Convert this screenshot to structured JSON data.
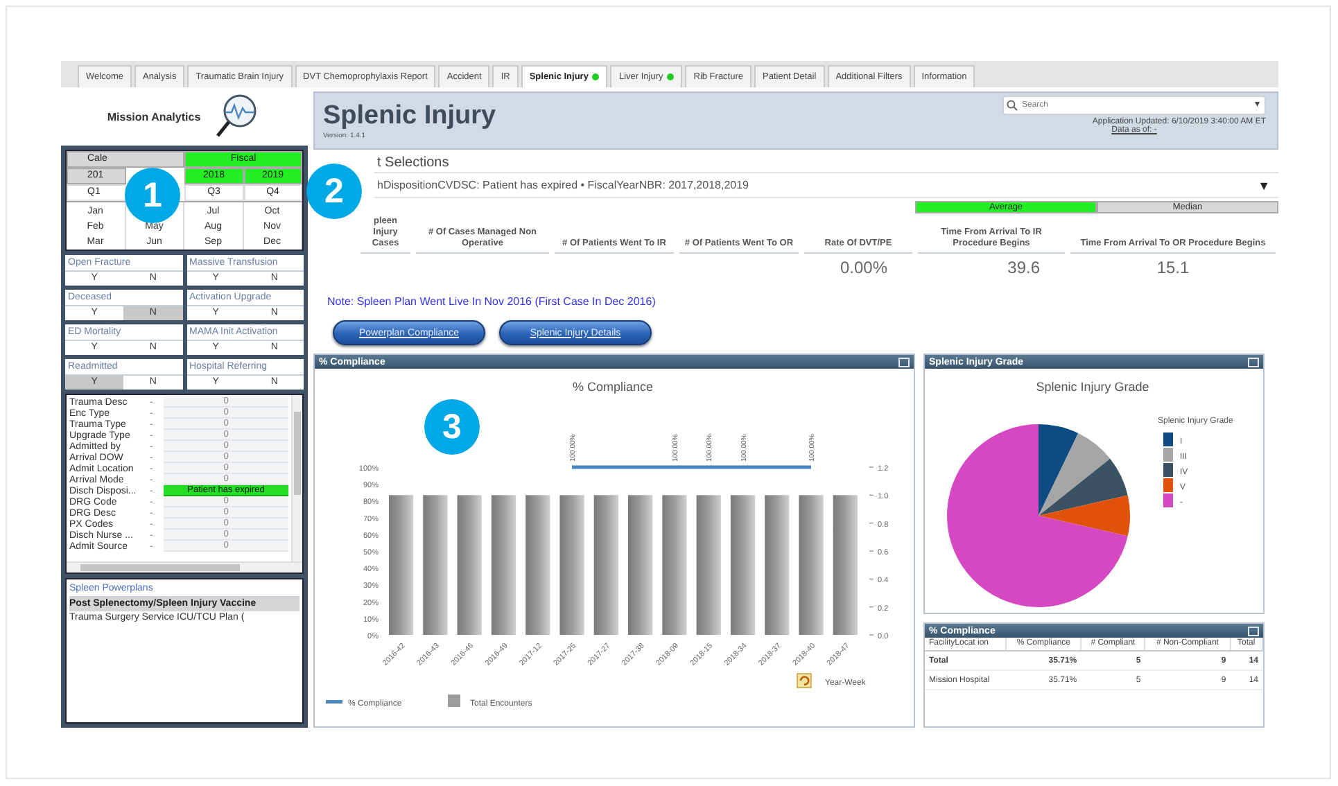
{
  "tabs": [
    {
      "label": "Welcome",
      "selected": false,
      "indicator": false
    },
    {
      "label": "Analysis",
      "selected": false,
      "indicator": false
    },
    {
      "label": "Traumatic Brain Injury",
      "selected": false,
      "indicator": false
    },
    {
      "label": "DVT Chemoprophylaxis Report",
      "selected": false,
      "indicator": false
    },
    {
      "label": "Accident",
      "selected": false,
      "indicator": false
    },
    {
      "label": "IR",
      "selected": false,
      "indicator": false
    },
    {
      "label": "Splenic Injury",
      "selected": true,
      "indicator": true
    },
    {
      "label": "Liver Injury",
      "selected": false,
      "indicator": true
    },
    {
      "label": "Rib Fracture",
      "selected": false,
      "indicator": false
    },
    {
      "label": "Patient Detail",
      "selected": false,
      "indicator": false
    },
    {
      "label": "Additional Filters",
      "selected": false,
      "indicator": false
    },
    {
      "label": "Information",
      "selected": false,
      "indicator": false
    }
  ],
  "sidebar": {
    "logo": "Mission Analytics",
    "date_filter": {
      "modes": [
        {
          "label": "Cale",
          "selected": false
        },
        {
          "label": "Fiscal",
          "selected": true
        }
      ],
      "years": [
        {
          "label": "201",
          "selected": false
        },
        {
          "kind": "covered"
        },
        {
          "label": "2018",
          "selected": true
        },
        {
          "label": "2019",
          "selected": true
        }
      ],
      "quarters": [
        {
          "label": "Q1"
        },
        {
          "kind": "covered"
        },
        {
          "label": "Q3"
        },
        {
          "label": "Q4"
        }
      ],
      "months": [
        [
          "Jan",
          "Feb",
          "Mar"
        ],
        [
          "May",
          "Jun"
        ],
        [
          "Jul",
          "Aug",
          "Sep"
        ],
        [
          "Oct",
          "Nov",
          "Dec"
        ]
      ]
    },
    "flags": [
      {
        "label": "Open Fracture",
        "options": [
          {
            "label": "Y",
            "selected": false
          },
          {
            "label": "N",
            "selected": false
          }
        ]
      },
      {
        "label": "Massive Transfusion",
        "options": [
          {
            "label": "Y",
            "selected": false
          },
          {
            "label": "N",
            "selected": false
          }
        ]
      },
      {
        "label": "Deceased",
        "options": [
          {
            "label": "Y",
            "selected": false
          },
          {
            "label": "N",
            "selected": true
          }
        ]
      },
      {
        "label": "Activation Upgrade",
        "options": [
          {
            "label": "Y",
            "selected": false
          },
          {
            "label": "N",
            "selected": false
          }
        ]
      },
      {
        "label": "ED Mortality",
        "options": [
          {
            "label": "Y",
            "selected": false
          },
          {
            "label": "N",
            "selected": false
          }
        ]
      },
      {
        "label": "MAMA Init Activation",
        "options": [
          {
            "label": "Y",
            "selected": false
          },
          {
            "label": "N",
            "selected": false
          }
        ]
      },
      {
        "label": "Readmitted",
        "options": [
          {
            "label": "Y",
            "selected": true
          },
          {
            "label": "N",
            "selected": false
          }
        ]
      },
      {
        "label": "Hospital Referring",
        "options": [
          {
            "label": "Y",
            "selected": false
          },
          {
            "label": "N",
            "selected": false
          }
        ]
      }
    ],
    "fields": [
      {
        "label": "Trauma Desc",
        "marker": "-",
        "value": "0",
        "selected": false
      },
      {
        "label": "Enc Type",
        "marker": "-",
        "value": "0",
        "selected": false
      },
      {
        "label": "Trauma Type",
        "marker": "-",
        "value": "0",
        "selected": false
      },
      {
        "label": "Upgrade Type",
        "marker": "-",
        "value": "0",
        "selected": false
      },
      {
        "label": "Admitted by",
        "marker": "-",
        "value": "0",
        "selected": false
      },
      {
        "label": "Arrival DOW",
        "marker": "-",
        "value": "0",
        "selected": false
      },
      {
        "label": "Admit Location",
        "marker": "-",
        "value": "0",
        "selected": false
      },
      {
        "label": "Arrival Mode",
        "marker": "-",
        "value": "0",
        "selected": false
      },
      {
        "label": "Disch Disposi...",
        "marker": "-",
        "value": "Patient has expired",
        "selected": true
      },
      {
        "label": "DRG Code",
        "marker": "-",
        "value": "0",
        "selected": false
      },
      {
        "label": "DRG Desc",
        "marker": "-",
        "value": "0",
        "selected": false
      },
      {
        "label": "PX Codes",
        "marker": "-",
        "value": "0",
        "selected": false
      },
      {
        "label": "Disch Nurse ...",
        "marker": "-",
        "value": "0",
        "selected": false
      },
      {
        "label": "Admit Source",
        "marker": "-",
        "value": "0",
        "selected": false
      }
    ],
    "powerplans": {
      "title": "Spleen Powerplans",
      "items": [
        {
          "label": "Post Splenectomy/Spleen Injury Vaccine",
          "selected": true
        },
        {
          "label": "Trauma Surgery Service ICU/TCU Plan (",
          "selected": false
        }
      ]
    }
  },
  "header": {
    "title": "Splenic Injury",
    "version": "Version: 1.4.1",
    "search": {
      "placeholder": "Search",
      "caret": "▾"
    },
    "updated": "Application Updated: 6/10/2019 3:40:00 AM ET",
    "data_as_of": "Data as of: -"
  },
  "selections": {
    "title": "t Selections",
    "text": "hDispositionCVDSC: Patient has expired • FiscalYearNBR: 2017,2018,2019",
    "caret": "▼"
  },
  "kpis": {
    "modes": [
      {
        "label": "Average",
        "selected": true
      },
      {
        "label": "Median",
        "selected": false
      }
    ],
    "columns": [
      {
        "label": "pleen Injury Cases"
      },
      {
        "label": "# Of Cases Managed Non Operative"
      },
      {
        "label": "# Of Patients Went To IR"
      },
      {
        "label": "# Of Patients Went To OR"
      },
      {
        "label": "Rate Of DVT/PE",
        "value": "0.00%"
      },
      {
        "label": "Time From Arrival To IR Procedure Begins",
        "value": "39.6"
      },
      {
        "label": "Time From Arrival To OR Procedure Begins",
        "value": "15.1"
      }
    ]
  },
  "note": "Note: Spleen Plan Went Live In Nov 2016 (First Case In Dec 2016)",
  "buttons": [
    "Powerplan Compliance",
    "Splenic Injury Details"
  ],
  "compliance_panel": {
    "title": "% Compliance",
    "dimension": "Year-Week",
    "chart_data": {
      "type": "bar",
      "title": "% Compliance",
      "categories": [
        "2016-42",
        "2016-43",
        "2016-46",
        "2016-49",
        "2017-12",
        "2017-25",
        "2017-27",
        "2017-38",
        "2018-09",
        "2018-15",
        "2018-34",
        "2018-37",
        "2018-40",
        "2018-47"
      ],
      "series": [
        {
          "name": "% Compliance",
          "color": "#4a86c0",
          "type": "line",
          "values": [
            null,
            null,
            null,
            null,
            null,
            100,
            null,
            null,
            100,
            100,
            100,
            null,
            100,
            null
          ],
          "value_labels": [
            null,
            null,
            null,
            null,
            null,
            "100.00%",
            null,
            null,
            "100.00%",
            "100.00%",
            "100.00%",
            null,
            "100.00%",
            null
          ]
        },
        {
          "name": "Total Encounters",
          "color": "#9c9c9c",
          "type": "bar",
          "axis": "y2",
          "values": [
            1,
            1,
            1,
            1,
            1,
            1,
            1,
            1,
            1,
            1,
            1,
            1,
            1,
            1
          ]
        }
      ],
      "yticks": [
        {
          "value": 0,
          "label": "0%"
        },
        {
          "value": 10,
          "label": "10%"
        },
        {
          "value": 20,
          "label": "20%"
        },
        {
          "value": 30,
          "label": "30%"
        },
        {
          "value": 40,
          "label": "40%"
        },
        {
          "value": 50,
          "label": "50%"
        },
        {
          "value": 60,
          "label": "60%"
        },
        {
          "value": 70,
          "label": "70%"
        },
        {
          "value": 80,
          "label": "80%"
        },
        {
          "value": 90,
          "label": "90%"
        },
        {
          "value": 100,
          "label": "100%"
        }
      ],
      "y2ticks": [
        {
          "value": 0,
          "label": "0.0"
        },
        {
          "value": 0.2,
          "label": "0.2"
        },
        {
          "value": 0.4,
          "label": "0.4"
        },
        {
          "value": 0.6,
          "label": "0.6"
        },
        {
          "value": 0.8,
          "label": "0.8"
        },
        {
          "value": 1,
          "label": "1.0"
        },
        {
          "value": 1.2,
          "label": "1.2"
        }
      ],
      "ylim": [
        0,
        100
      ],
      "y2lim": [
        0,
        1.2
      ],
      "legend": "bottom"
    }
  },
  "grade_panel": {
    "title": "Splenic Injury Grade",
    "chart_title": "Splenic Injury Grade",
    "legend_title": "Splenic Injury Grade",
    "legend": [
      {
        "label": "I",
        "color": "#0d4c82"
      },
      {
        "label": "III",
        "color": "#a6a6a6"
      },
      {
        "label": "IV",
        "color": "#3b5262"
      },
      {
        "label": "V",
        "color": "#e0520c"
      },
      {
        "label": "-",
        "color": "#d648c2"
      }
    ]
  },
  "table_panel": {
    "title": "% Compliance",
    "columns": [
      "FacilityLocat ion",
      "% Compliance",
      "# Compliant",
      "# Non-Compliant",
      "Total"
    ],
    "rows": [
      {
        "total": true,
        "cells": [
          "Total",
          "35.71%",
          "5",
          "9",
          "14"
        ]
      },
      {
        "total": false,
        "cells": [
          "Mission Hospital",
          "35.71%",
          "5",
          "9",
          "14"
        ]
      }
    ]
  },
  "callouts": [
    {
      "label": "1"
    },
    {
      "label": "2"
    },
    {
      "label": "3"
    }
  ]
}
